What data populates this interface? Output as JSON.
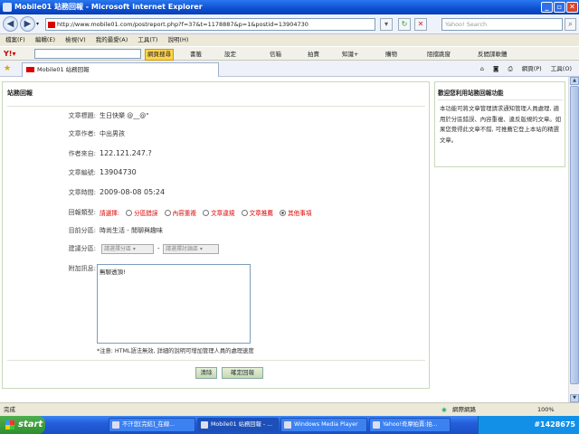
{
  "window": {
    "title": "Mobile01 站務回報 - Microsoft Internet Explorer",
    "url": "http://www.mobile01.com/postreport.php?f=37&t=1178887&p=1&postid=13904730",
    "search_placeholder": "Yahoo! Search"
  },
  "menu": [
    "檔案(F)",
    "編輯(E)",
    "檢視(V)",
    "我的最愛(A)",
    "工具(T)",
    "說明(H)"
  ],
  "toolbar": {
    "search_button": "網頁搜尋",
    "items": [
      "書籤",
      "設定",
      "信箱",
      "拍賣",
      "知識+",
      "購物",
      "阻擋跳窗",
      "反間諜軟體"
    ]
  },
  "tab": {
    "label": "Mobile01 站務回報",
    "tools": [
      "網頁(P)",
      "工具(O)"
    ]
  },
  "form": {
    "title": "站務回報",
    "fields": [
      {
        "label": "文章標題:",
        "value": "生日快樂 @__@\""
      },
      {
        "label": "文章作者:",
        "value": "中出男孩"
      },
      {
        "label": "作者來自:",
        "value": "122.121.247.?"
      },
      {
        "label": "文章編號:",
        "value": "13904730"
      },
      {
        "label": "文章時間:",
        "value": "2009-08-08 05:24"
      }
    ],
    "report_type_label": "回報類型:",
    "report_type_prompt": "請選擇:",
    "report_types": [
      "分區錯誤",
      "內容重複",
      "文章違規",
      "文章推薦",
      "其他事項"
    ],
    "report_type_selected": "其他事項",
    "category_label": "目前分區:",
    "category_value": "時尚生活 - 閒聊與趣味",
    "suggest_label": "建議分區:",
    "suggest_select1": "請選擇分區",
    "suggest_dash": "-",
    "suggest_select2": "請選擇討論區",
    "message_label": "附加訊息:",
    "message_value": "無聊透頂!",
    "note": "*注意: HTML語法無效, 詳細的說明可增加管理人員的處理速度",
    "clear_button": "清除",
    "submit_button": "確定回報"
  },
  "sidebar": {
    "title": "歡迎您利用站務回報功能",
    "text": "本功能可將文章管理請求通知管理人員處理, 適用於分區錯誤、內容重複、違反版規的文章。如果您覺得此文章不錯, 可推薦它登上本站的精選文章。"
  },
  "status": {
    "left": "完成",
    "zone": "網際網路",
    "zoom": "100%"
  },
  "taskbar": {
    "start": "start",
    "tasks": [
      "不汗您[完結]_在線...",
      "Mobile01 站務回報 - ...",
      "Windows Media Player",
      "Yahoo!奇摩拍賣:拍..."
    ],
    "tray": "#1428675"
  }
}
